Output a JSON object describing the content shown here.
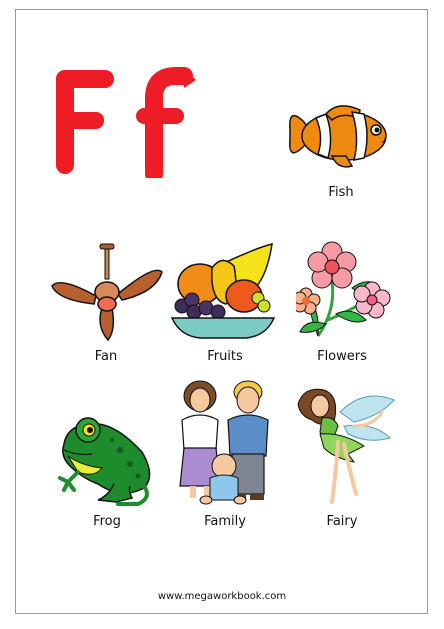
{
  "letters": {
    "upper": "F",
    "lower": "f",
    "color": "#ee1c25"
  },
  "items": [
    {
      "word": "Fish",
      "icon": "fish-icon"
    },
    {
      "word": "Fan",
      "icon": "ceiling-fan-icon"
    },
    {
      "word": "Fruits",
      "icon": "fruit-bowl-icon"
    },
    {
      "word": "Flowers",
      "icon": "flowers-icon"
    },
    {
      "word": "Frog",
      "icon": "frog-icon"
    },
    {
      "word": "Family",
      "icon": "family-icon"
    },
    {
      "word": "Fairy",
      "icon": "fairy-icon"
    }
  ],
  "footer": {
    "website": "www.megaworkbook.com"
  }
}
